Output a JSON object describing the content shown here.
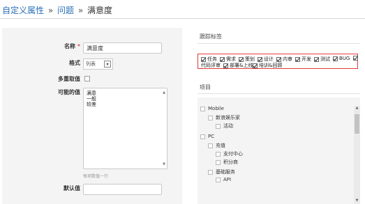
{
  "breadcrumb": {
    "items": [
      "自定义属性",
      "问题",
      "满意度"
    ],
    "separator": "»"
  },
  "form": {
    "name_label": "名称",
    "required_mark": "*",
    "name_value": "满意度",
    "format_label": "格式",
    "format_value": "列表",
    "multi_label": "多重取值",
    "multi_checked": false,
    "values_label": "可能的值",
    "values_lines": [
      "满意",
      "一般",
      "较差"
    ],
    "values_hint": "每项数值一行",
    "default_label": "默认值",
    "default_value": ""
  },
  "tags": {
    "title": "跟踪标签",
    "items": [
      {
        "label": "任务",
        "checked": true
      },
      {
        "label": "需求",
        "checked": true
      },
      {
        "label": "策划",
        "checked": true
      },
      {
        "label": "设计",
        "checked": true
      },
      {
        "label": "内审",
        "checked": true
      },
      {
        "label": "开发",
        "checked": true
      },
      {
        "label": "测试",
        "checked": true
      },
      {
        "label": "BUG",
        "checked": true
      },
      {
        "label": "代码评审",
        "checked": true
      },
      {
        "label": "部署&上线",
        "checked": true
      },
      {
        "label": "培训&回顾",
        "checked": true
      }
    ],
    "highlight_color": "#e03a3a"
  },
  "projects": {
    "title": "项目",
    "tree": [
      {
        "label": "Mobile"
      },
      {
        "label": "新浪娱乐家"
      },
      {
        "label": "活动"
      },
      {
        "label": "PC"
      },
      {
        "label": "充值"
      },
      {
        "label": "支付中心"
      },
      {
        "label": "积分商"
      },
      {
        "label": "基础服务"
      },
      {
        "label": "API"
      }
    ]
  },
  "colors": {
    "link": "#2a6fb8",
    "panel_bg": "#f4f4f4"
  }
}
